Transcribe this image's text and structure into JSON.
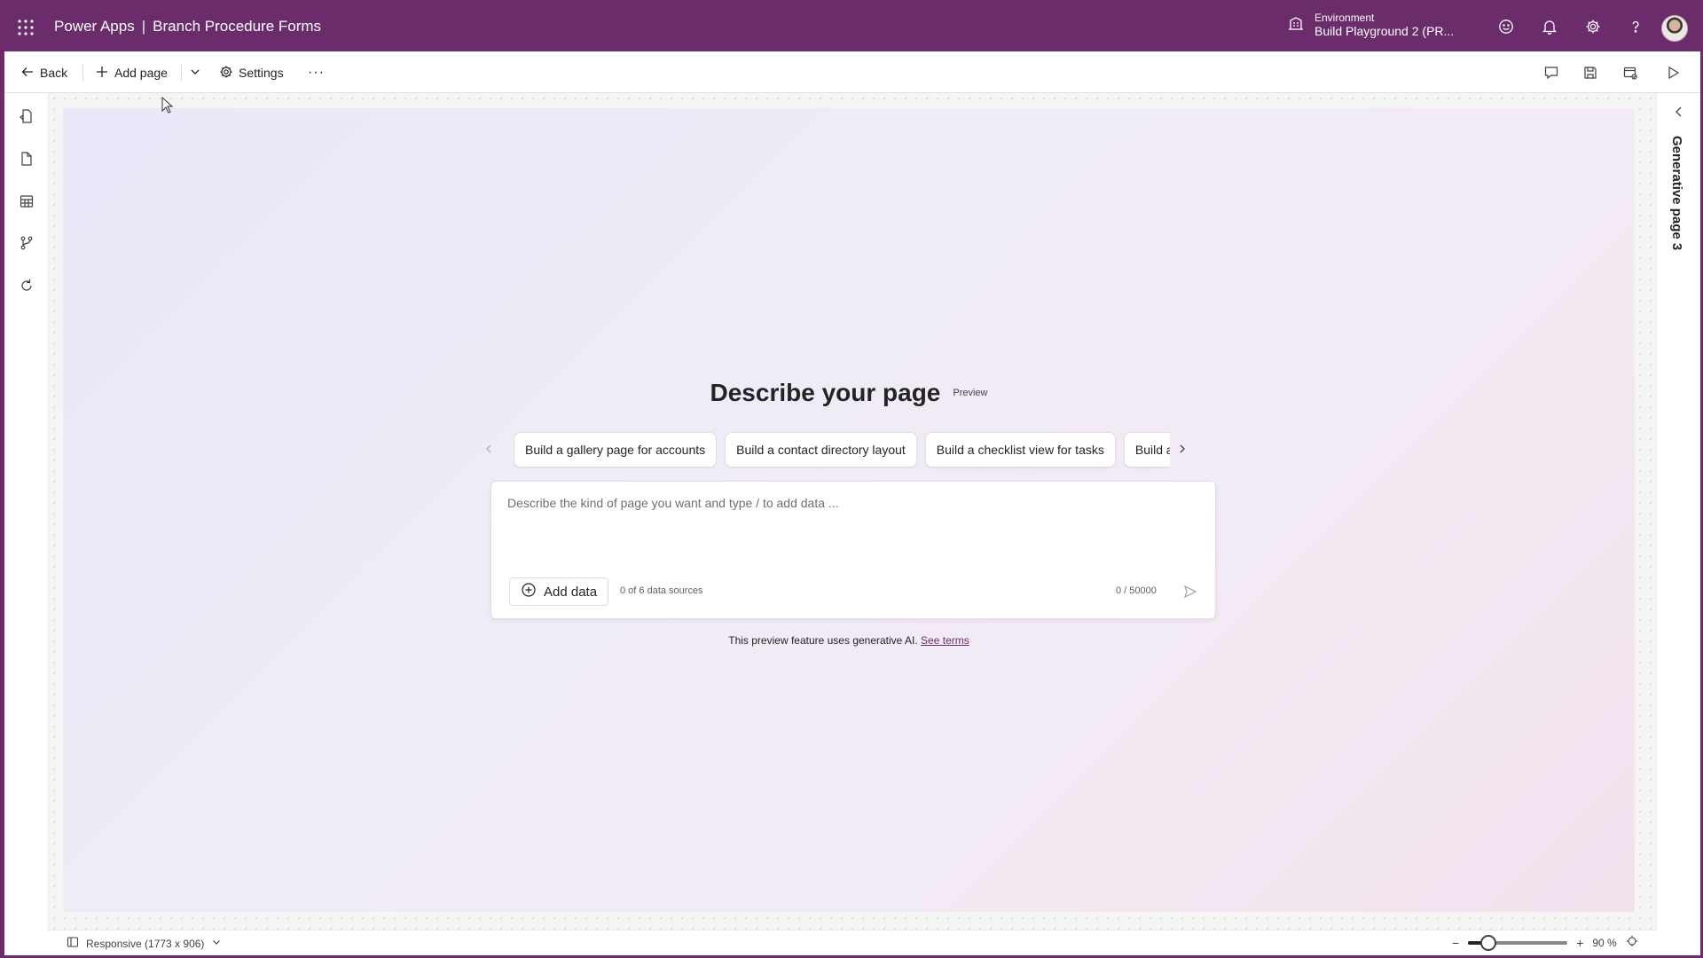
{
  "header": {
    "app_name": "Power Apps",
    "separator": "|",
    "app_title": "Branch Procedure Forms",
    "environment_label": "Environment",
    "environment_value": "Build Playground 2 (PR...",
    "icons": [
      "waffle-icon",
      "environment-icon",
      "feedback-icon",
      "bell-icon",
      "gear-icon",
      "help-icon",
      "avatar"
    ]
  },
  "toolbar": {
    "back_label": "Back",
    "add_page_label": "Add page",
    "settings_label": "Settings",
    "more_label": "···"
  },
  "canvas": {
    "title": "Describe your page",
    "preview_badge": "Preview",
    "suggestions": [
      "Build a gallery page for accounts",
      "Build a contact directory layout",
      "Build a checklist view for tasks",
      "Build a"
    ],
    "prompt_placeholder": "Describe the kind of page you want and type / to add data ...",
    "add_data_label": "Add data",
    "data_sources": "0 of 6 data sources",
    "char_counter": "0 / 50000",
    "disclaimer": "This preview feature uses generative AI.",
    "see_terms": "See terms"
  },
  "right_panel": {
    "title": "Generative page 3"
  },
  "statusbar": {
    "responsive_label": "Responsive (1773 x 906)",
    "zoom_minus": "−",
    "zoom_plus": "+",
    "zoom_level": "90 %",
    "zoom_fraction": 0.2
  },
  "colors": {
    "brand": "#6b2c6b",
    "link": "#6b2c6b"
  }
}
